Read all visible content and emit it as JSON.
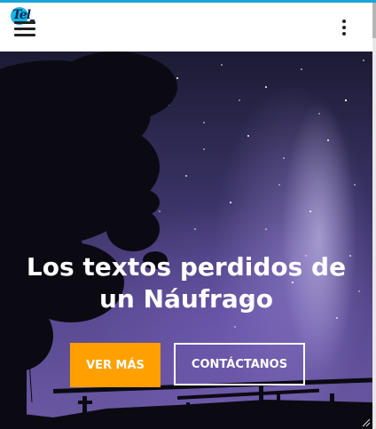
{
  "header": {
    "logo_text": "Tel",
    "menu_icon": "hamburger-menu-icon",
    "more_icon": "vertical-dots-icon"
  },
  "hero": {
    "title_line1": "Los textos perdidos de",
    "title_line2": "un Náufrago",
    "primary_button": "VER MÁS",
    "secondary_button": "CONTÁCTANOS"
  },
  "colors": {
    "accent_line": "#1aa3d9",
    "primary_button": "#ffa000",
    "logo": "#18b6e6"
  }
}
